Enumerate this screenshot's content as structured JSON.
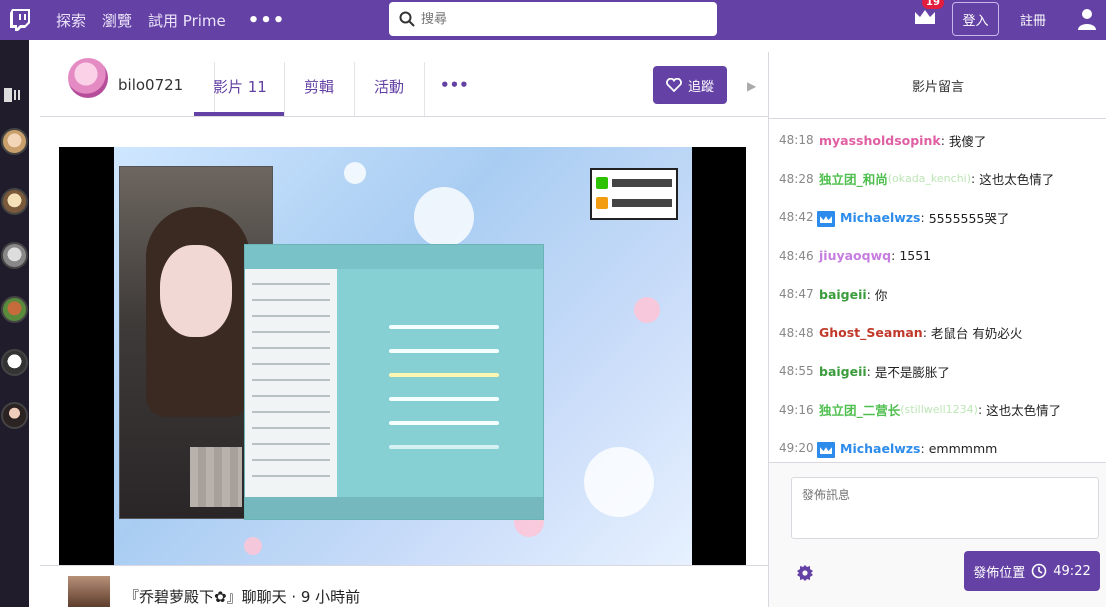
{
  "topnav": {
    "links": [
      "探索",
      "瀏覽",
      "試用 Prime"
    ],
    "more": "•••",
    "search_placeholder": "搜尋",
    "notification_count": "19",
    "login": "登入",
    "register": "註冊"
  },
  "channel": {
    "name": "bilo0721",
    "tabs": [
      {
        "label": "影片 11"
      },
      {
        "label": "剪輯"
      },
      {
        "label": "活動"
      }
    ],
    "more": "•••",
    "follow": "追蹤"
  },
  "video": {
    "title": "『乔碧萝殿下✿』聊聊天 · 9 小時前"
  },
  "chat": {
    "title": "影片留言",
    "input_placeholder": "發佈訊息",
    "send_label": "發佈位置",
    "send_time": "49:22",
    "messages": [
      {
        "ts": "48:18",
        "user": "myassholdsopink",
        "color": "#e05fa3",
        "text": "我傻了",
        "mod": false,
        "sub": ""
      },
      {
        "ts": "48:28",
        "user": "独立团_和尚",
        "color": "#4fbf4f",
        "text": "这也太色情了",
        "mod": false,
        "sub": "(okada_kenchi)"
      },
      {
        "ts": "48:42",
        "user": "Michaelwzs",
        "color": "#2d8ceb",
        "text": "5555555哭了",
        "mod": true,
        "sub": ""
      },
      {
        "ts": "48:46",
        "user": "jiuyaoqwq",
        "color": "#c77de0",
        "text": "1551",
        "mod": false,
        "sub": ""
      },
      {
        "ts": "48:47",
        "user": "baigeii",
        "color": "#3b9c3b",
        "text": "你",
        "mod": false,
        "sub": ""
      },
      {
        "ts": "48:48",
        "user": "Ghost_Seaman",
        "color": "#c0392b",
        "text": "老鼠台 有奶必火",
        "mod": false,
        "sub": ""
      },
      {
        "ts": "48:55",
        "user": "baigeii",
        "color": "#3b9c3b",
        "text": "是不是膨胀了",
        "mod": false,
        "sub": ""
      },
      {
        "ts": "49:16",
        "user": "独立团_二营长",
        "color": "#4fbf4f",
        "text": "这也太色情了",
        "mod": false,
        "sub": "(stillwell1234)"
      },
      {
        "ts": "49:20",
        "user": "Michaelwzs",
        "color": "#2d8ceb",
        "text": "emmmmm",
        "mod": true,
        "sub": ""
      }
    ]
  }
}
